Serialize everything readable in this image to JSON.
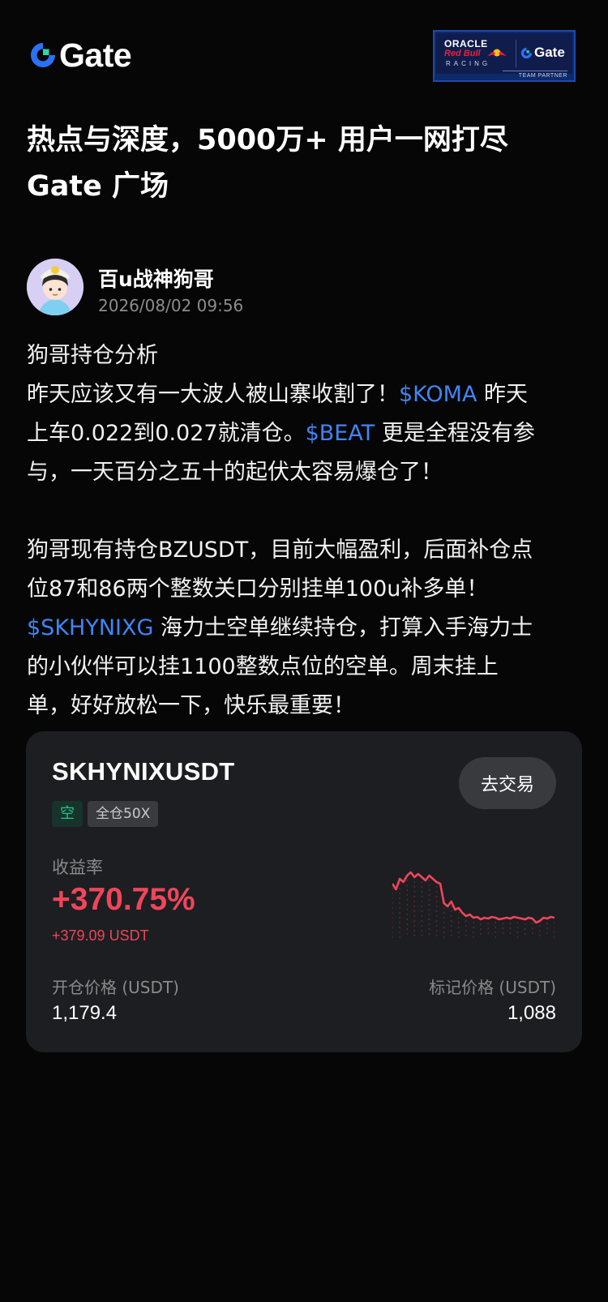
{
  "header": {
    "logo_text": "Gate",
    "partner": {
      "oracle": "ORACLE",
      "redbull": "Red Bull",
      "racing": "RACING",
      "gate": "Gate",
      "footer": "TEAM PARTNER"
    }
  },
  "headline": {
    "line1": "热点与深度，5000万+ 用户一网打尽",
    "line2": "Gate 广场"
  },
  "post": {
    "author": "百u战神狗哥",
    "time": "2026/08/02 09:56",
    "lines": [
      {
        "text": "狗哥持仓分析"
      },
      {
        "pre": "昨天应该又有一大波人被山寨收割了！",
        "tag": "$KOMA",
        "post": " 昨天"
      },
      {
        "pre": "上车0.022到0.027就清仓。",
        "tag": "$BEAT",
        "post": " 更是全程没有参"
      },
      {
        "text": "与，一天百分之五十的起伏太容易爆仓了！"
      },
      {
        "text": ""
      },
      {
        "text": "狗哥现有持仓BZUSDT，目前大幅盈利，后面补仓点"
      },
      {
        "text": "位87和86两个整数关口分别挂单100u补多单！"
      },
      {
        "pre": "",
        "tag": "$SKHYNIXG",
        "post": " 海力士空单继续持仓，打算入手海力士"
      },
      {
        "text": "的小伙伴可以挂1100整数点位的空单。周末挂上"
      },
      {
        "text": "单，好好放松一下，快乐最重要！"
      }
    ]
  },
  "card": {
    "pair": "SKHYNIXUSDT",
    "trade_button": "去交易",
    "side": "空",
    "leverage": "全仓50X",
    "roi_label": "收益率",
    "roi_value": "+370.75%",
    "roi_usdt": "+379.09 USDT",
    "open_label": "开仓价格 (USDT)",
    "open_value": "1,179.4",
    "mark_label": "标记价格 (USDT)",
    "mark_value": "1,088",
    "colors": {
      "profit": "#f0455b",
      "short": "#21c485"
    },
    "sparkline": {
      "type": "line",
      "values": [
        62,
        55,
        68,
        64,
        72,
        76,
        70,
        74,
        70,
        66,
        72,
        68,
        64,
        62,
        38,
        34,
        40,
        30,
        32,
        26,
        22,
        24,
        20,
        21,
        18,
        20,
        19,
        21,
        20,
        18,
        19,
        20,
        19,
        21,
        20,
        19,
        18,
        20,
        19,
        14,
        16,
        20,
        19,
        21,
        20
      ]
    }
  }
}
